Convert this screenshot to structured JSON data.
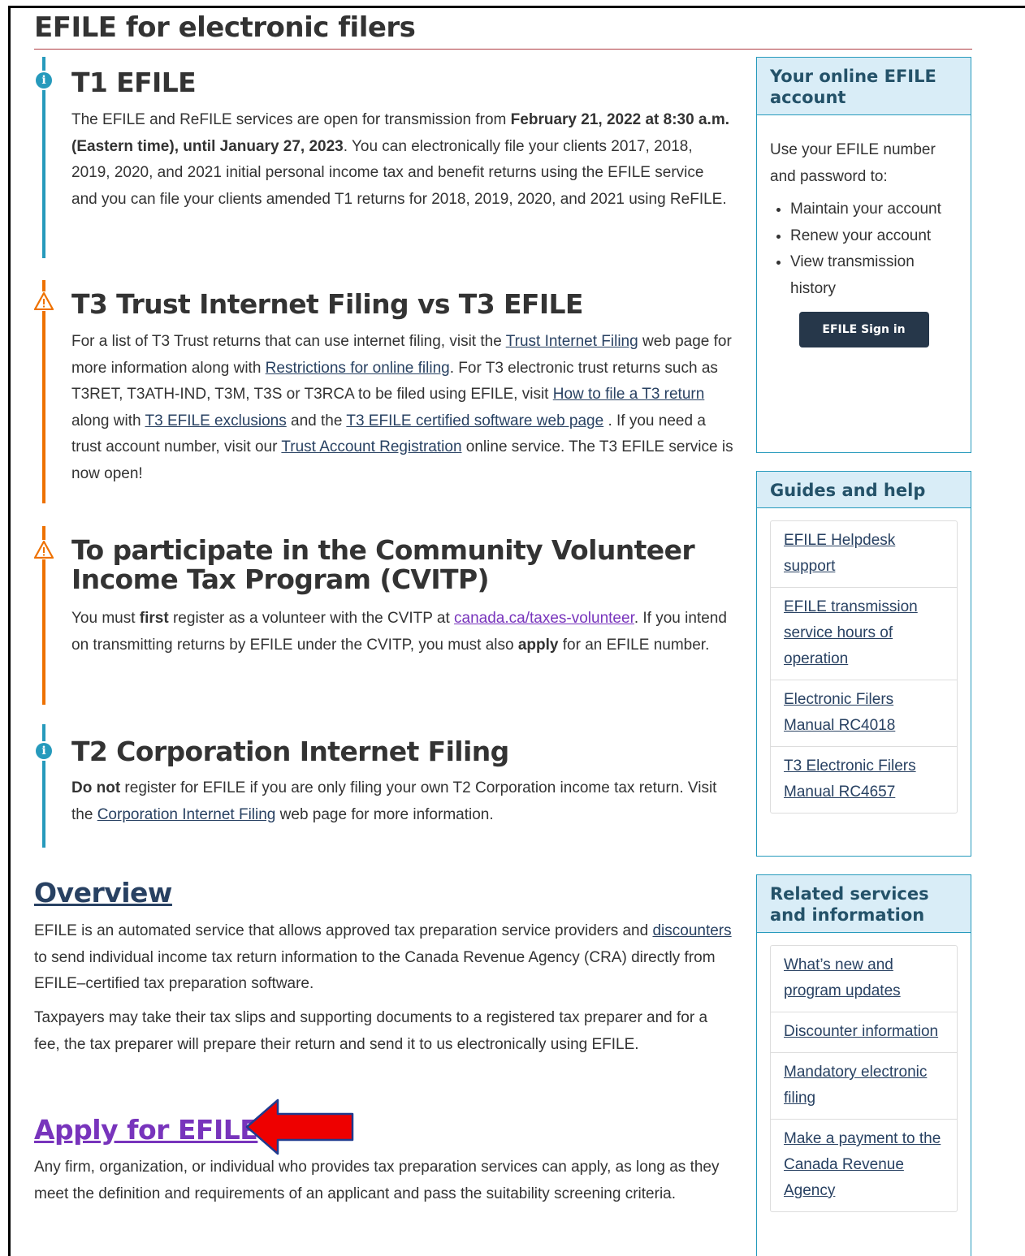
{
  "page": {
    "title": "EFILE for electronic filers"
  },
  "alerts": {
    "t1": {
      "heading": "T1 EFILE",
      "text_1": "The EFILE and ReFILE services are open for transmission from ",
      "bold_1": "February 21, 2022 at 8:30 a.m. (Eastern time), until January 27, 2023",
      "text_2": ". You can electronically file your clients 2017, 2018, 2019, 2020, and 2021 initial personal income tax and benefit returns using the EFILE service and you can file your clients amended T1 returns for 2018, 2019, 2020, and 2021 using ReFILE."
    },
    "t3": {
      "heading": "T3 Trust Internet Filing vs T3 EFILE",
      "text_1": "For a list of T3 Trust returns that can use internet filing, visit the ",
      "link_trust_internet": "Trust Internet Filing",
      "text_2": " web page for more information along with ",
      "link_restrictions": "Restrictions for online filing",
      "text_3": ". For T3 electronic trust returns such as T3RET, T3ATH-IND, T3M, T3S or T3RCA to be filed using EFILE, visit ",
      "link_how_to_file": "How to file a T3 return",
      "text_4": " along with ",
      "link_exclusions": "T3 EFILE exclusions",
      "text_5": " and the ",
      "link_certified": "T3 EFILE certified software web page",
      "text_6": " . If you need a trust account number, visit our ",
      "link_trust_reg": "Trust Account Registration",
      "text_7": " online service. The T3 EFILE service is now open!"
    },
    "cvitp": {
      "heading_line1": "To participate in the Community Volunteer",
      "heading_line2": "Income Tax Program (CVITP)",
      "text_1": "You must ",
      "bold_first": "first",
      "text_2": " register as a volunteer with the CVITP at ",
      "link_volunteer": "canada.ca/taxes-volunteer",
      "text_3": ". If you intend on transmitting returns by EFILE under the CVITP, you must also ",
      "bold_apply": "apply",
      "text_4": " for an EFILE number."
    },
    "t2": {
      "heading": "T2 Corporation Internet Filing",
      "bold_do_not": "Do not",
      "text_1": " register for EFILE if you are only filing your own T2 Corporation income tax return. Visit the ",
      "link_corp": "Corporation Internet Filing",
      "text_2": " web page for more information."
    }
  },
  "overview": {
    "heading": "Overview",
    "p1_text_1": "EFILE is an automated service that allows approved tax preparation service providers and ",
    "p1_link": "discounters",
    "p1_text_2": " to send individual income tax return information to the Canada Revenue Agency (CRA) directly from EFILE–certified tax preparation software.",
    "p2": "Taxpayers may take their tax slips and supporting documents to a registered tax preparer and for a fee, the tax preparer will prepare their return and send it to us electronically using EFILE."
  },
  "apply": {
    "heading": "Apply for EFILE",
    "text": "Any firm, organization, or individual who provides tax preparation services can apply, as long as they meet the definition and requirements of an applicant and pass the suitability screening criteria."
  },
  "sidebar": {
    "account": {
      "title": "Your online EFILE account",
      "intro": "Use your EFILE number and password to:",
      "items": [
        "Maintain your account",
        "Renew your account",
        "View transmission history"
      ],
      "button": "EFILE Sign in"
    },
    "guides": {
      "title": "Guides and help",
      "links": [
        "EFILE Helpdesk support",
        "EFILE transmission service hours of operation",
        "Electronic Filers Manual RC4018",
        "T3 Electronic Filers Manual RC4657"
      ]
    },
    "related": {
      "title": "Related services and information",
      "links": [
        "What’s new and program updates",
        "Discounter information",
        "Mandatory electronic filing",
        "Make a payment to the Canada Revenue Agency"
      ]
    }
  },
  "colors": {
    "info": "#269abc",
    "warning": "#ee7100",
    "link": "#284162",
    "visited_link": "#7834bc",
    "arrow": "#ee0000"
  }
}
